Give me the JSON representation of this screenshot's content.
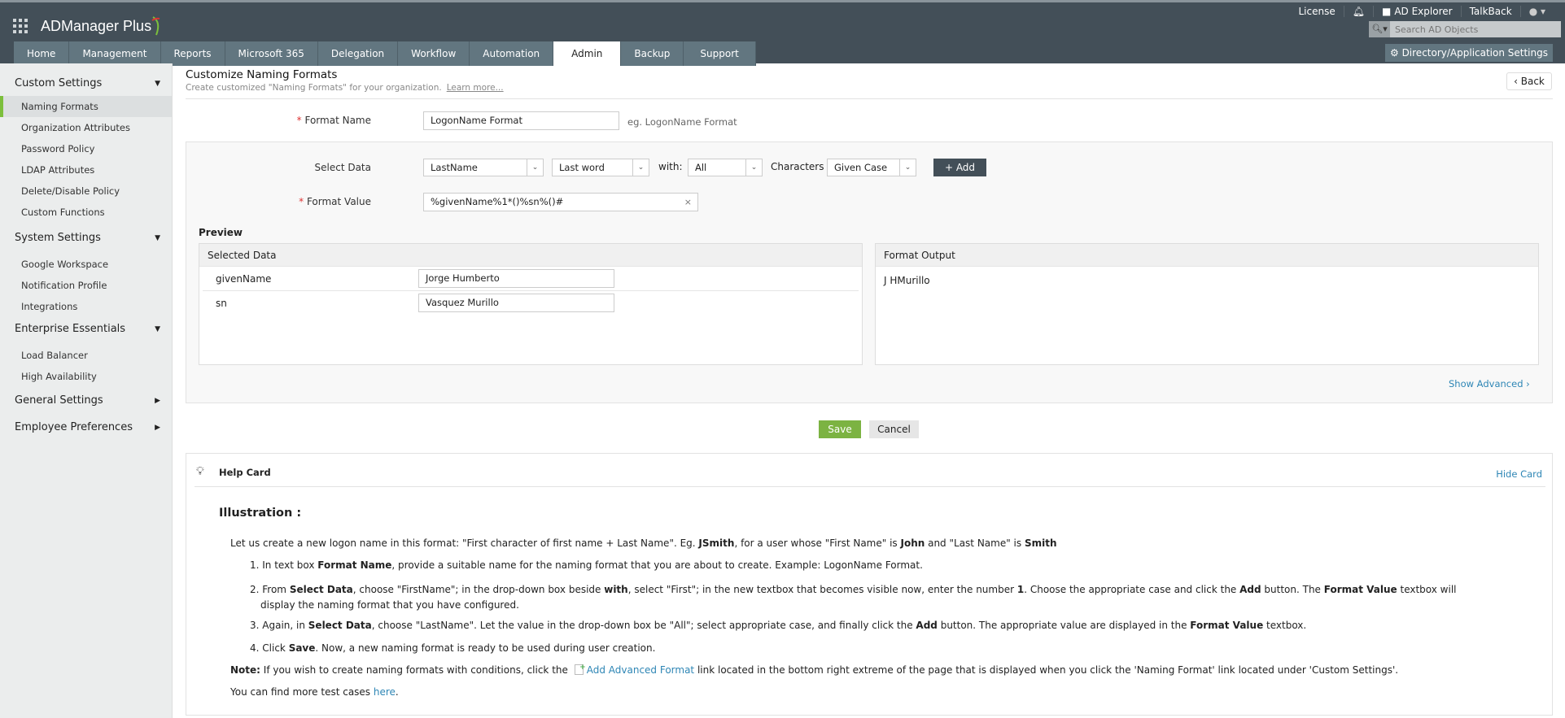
{
  "app": {
    "name": "ADManager Plus"
  },
  "top_links": {
    "license": "License",
    "ad_explorer": "AD Explorer",
    "talkback": "TalkBack"
  },
  "search": {
    "placeholder": "Search AD Objects"
  },
  "dir_settings": "Directory/Application Settings",
  "tabs": [
    "Home",
    "Management",
    "Reports",
    "Microsoft 365",
    "Delegation",
    "Workflow",
    "Automation",
    "Admin",
    "Backup",
    "Support"
  ],
  "active_tab": "Admin",
  "sidebar": {
    "custom_settings": "Custom Settings",
    "custom_items": [
      "Naming Formats",
      "Organization Attributes",
      "Password Policy",
      "LDAP Attributes",
      "Delete/Disable Policy",
      "Custom Functions"
    ],
    "system_settings": "System Settings",
    "system_items": [
      "Google Workspace",
      "Notification Profile",
      "Integrations"
    ],
    "enterprise": "Enterprise Essentials",
    "enterprise_items": [
      "Load Balancer",
      "High Availability"
    ],
    "general": "General Settings",
    "employee": "Employee Preferences"
  },
  "page": {
    "title": "Customize Naming Formats",
    "subtitle": "Create customized \"Naming Formats\" for your organization.",
    "learn_more": "Learn more...",
    "back": "Back"
  },
  "form": {
    "format_name_label": "Format Name",
    "format_name_value": "LogonName Format",
    "format_name_hint": "eg. LogonName Format",
    "select_data_label": "Select Data",
    "select_data": "LastName",
    "word": "Last word",
    "with_label": "with:",
    "with_value": "All",
    "characters_label": "Characters",
    "case": "Given Case",
    "add": "Add",
    "format_value_label": "Format Value",
    "format_value": "%givenName%1*()%sn%()#",
    "preview": "Preview",
    "selected_data": "Selected Data",
    "format_output": "Format Output",
    "rows": [
      {
        "attr": "givenName",
        "value": "Jorge Humberto"
      },
      {
        "attr": "sn",
        "value": "Vasquez Murillo"
      }
    ],
    "output": "J HMurillo",
    "show_advanced": "Show Advanced"
  },
  "actions": {
    "save": "Save",
    "cancel": "Cancel"
  },
  "help": {
    "title": "Help Card",
    "hide": "Hide Card",
    "illustration": "Illustration :",
    "intro": [
      "Let us create a new logon name in this format: \"First character of first name + Last Name\". Eg. ",
      "JSmith",
      ", for a user whose \"First Name\" is ",
      "John",
      " and \"Last Name\" is ",
      "Smith"
    ],
    "s1": [
      "In text box ",
      "Format Name",
      ", provide a suitable name for the naming format that you are about to create. Example: LogonName Format."
    ],
    "s2": [
      "From ",
      "Select Data",
      ", choose \"FirstName\"; in the drop-down box beside ",
      "with",
      ", select \"First\"; in the new textbox that becomes visible now, enter the number ",
      "1",
      ". Choose the appropriate case and click the ",
      "Add",
      " button. The ",
      "Format Value",
      " textbox will display the naming format that you have configured."
    ],
    "s3": [
      "Again, in ",
      "Select Data",
      ", choose \"LastName\". Let the value in the drop-down box be \"All\"; select appropriate case, and finally click the ",
      "Add",
      " button. The appropriate value are displayed in the ",
      "Format Value",
      " textbox."
    ],
    "s4": [
      "Click ",
      "Save",
      ". Now, a new naming format is ready to be used during user creation."
    ],
    "note": [
      "Note:",
      " If you wish to create naming formats with conditions, click the ",
      "Add Advanced Format",
      " link located in the bottom right extreme of the page that is displayed when you click the 'Naming Format' link located under 'Custom Settings'."
    ],
    "more": [
      "You can find more test cases ",
      "here",
      "."
    ]
  }
}
